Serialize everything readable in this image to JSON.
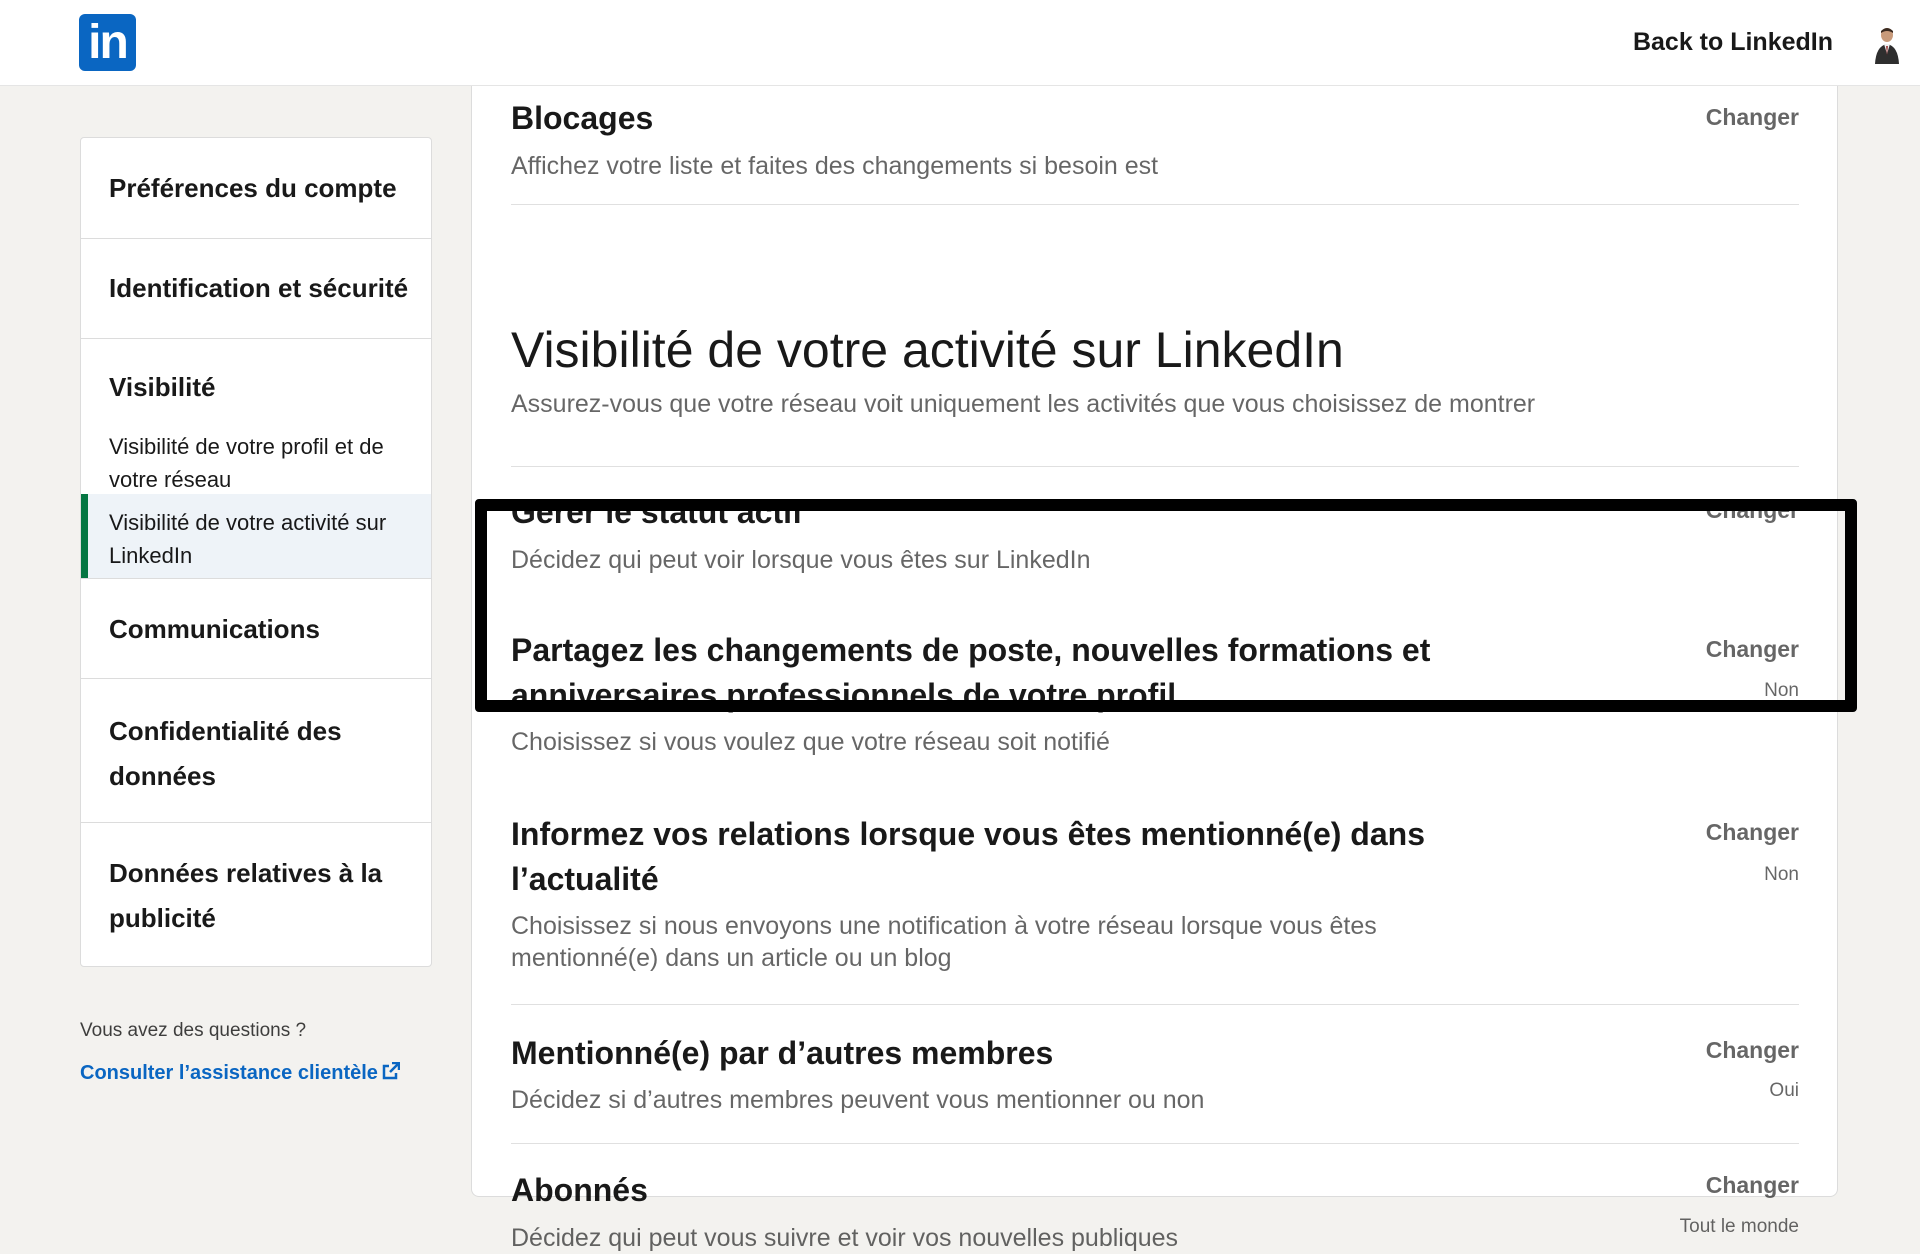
{
  "header": {
    "logo_text": "in",
    "back_link": "Back to LinkedIn"
  },
  "sidebar": {
    "sections": [
      {
        "label": "Préférences du compte"
      },
      {
        "label": "Identification et sécurité"
      },
      {
        "label": "Visibilité"
      },
      {
        "label": "Communications"
      },
      {
        "label": "Confidentialité des données"
      },
      {
        "label": "Données relatives à la publicité"
      }
    ],
    "visibility_items": [
      {
        "label": "Visibilité de votre profil et de votre réseau"
      },
      {
        "label": "Visibilité de votre activité sur LinkedIn",
        "active": true
      }
    ],
    "help_question": "Vous avez des questions ?",
    "help_link": "Consulter l’assistance clientèle"
  },
  "main": {
    "blocking": {
      "title": "Blocages",
      "description": "Affichez votre liste et faites des changements si besoin est",
      "action": "Changer"
    },
    "section_heading": "Visibilité de votre activité sur LinkedIn",
    "section_subtitle": "Assurez-vous que votre réseau voit uniquement les activités que vous choisissez de montrer",
    "settings": [
      {
        "title": "Gérer le statut actif",
        "description": "Décidez qui peut voir lorsque vous êtes sur LinkedIn",
        "action": "Changer",
        "value": ""
      },
      {
        "title": "Partagez les changements de poste, nouvelles formations et anniversaires professionnels de votre profil",
        "description": "Choisissez si vous voulez que votre réseau soit notifié",
        "action": "Changer",
        "value": "Non"
      },
      {
        "title": "Informez vos relations lorsque vous êtes mentionné(e) dans l’actualité",
        "description": "Choisissez si nous envoyons une notification à votre réseau lorsque vous êtes mentionné(e) dans un article ou un blog",
        "action": "Changer",
        "value": "Non"
      },
      {
        "title": "Mentionné(e) par d’autres membres",
        "description": "Décidez si d’autres membres peuvent vous mentionner ou non",
        "action": "Changer",
        "value": "Oui"
      },
      {
        "title": "Abonnés",
        "description": "Décidez qui peut vous suivre et voir vos nouvelles publiques",
        "action": "Changer",
        "value": "Tout le monde"
      }
    ]
  },
  "colors": {
    "brand": "#0a66c2",
    "active_indicator": "#057642",
    "active_bg": "#eef3f8",
    "page_bg": "#f3f2ef"
  }
}
